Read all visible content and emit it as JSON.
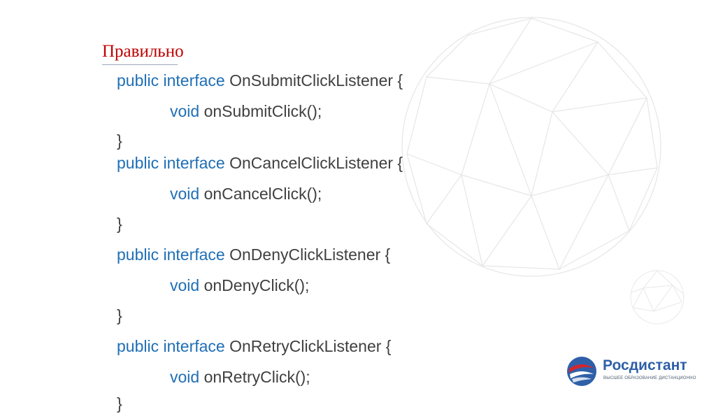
{
  "slide": {
    "title": "Правильно",
    "code_lines": [
      {
        "kw1": "public",
        "kw2": "interface",
        "rest": "OnSubmitClickListener {"
      },
      {
        "kw1": "void",
        "rest": "onSubmitClick();"
      },
      {
        "rest": "}"
      },
      {
        "kw1": "public",
        "kw2": "interface",
        "rest": "OnCancelClickListener {"
      },
      {
        "kw1": "void",
        "rest": "onCancelClick();"
      },
      {
        "rest": "}"
      },
      {
        "kw1": "public",
        "kw2": "interface",
        "rest": "OnDenyClickListener {"
      },
      {
        "kw1": "void",
        "rest": "onDenyClick();"
      },
      {
        "rest": "}"
      },
      {
        "kw1": "public",
        "kw2": "interface",
        "rest": "OnRetryClickListener {"
      },
      {
        "kw1": "void",
        "rest": "onRetryClick();"
      },
      {
        "rest": "}"
      }
    ]
  },
  "logo": {
    "name": "Росдистант",
    "tagline": "ВЫСШЕЕ ОБРАЗОВАНИЕ ДИСТАНЦИОННО"
  },
  "colors": {
    "title": "#c00000",
    "keyword": "#1f6fb5",
    "code_text": "#404040",
    "logo_blue": "#2f5fa8",
    "logo_red": "#d3262e"
  }
}
